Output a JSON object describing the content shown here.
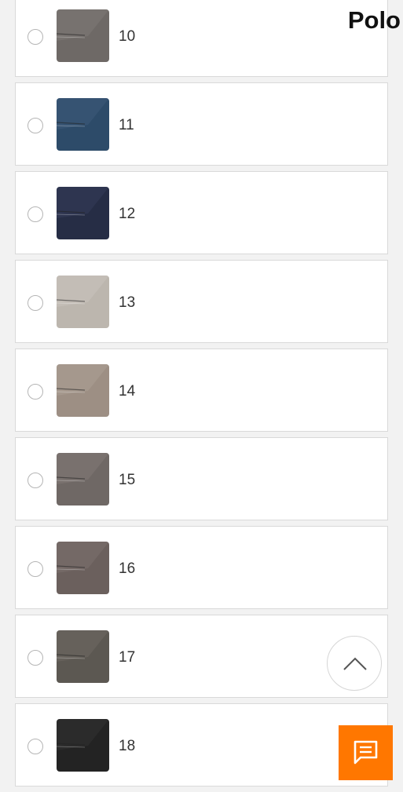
{
  "header": {
    "title": "Polo"
  },
  "options": [
    {
      "code": "10",
      "color": "#6e6966",
      "fold": "#8a8581"
    },
    {
      "code": "11",
      "color": "#2d4b69",
      "fold": "#486584"
    },
    {
      "code": "12",
      "color": "#262d45",
      "fold": "#3e4563"
    },
    {
      "code": "13",
      "color": "#bcb6ae",
      "fold": "#d1ccc5"
    },
    {
      "code": "14",
      "color": "#9d8f84",
      "fold": "#b5a89d"
    },
    {
      "code": "15",
      "color": "#6f6865",
      "fold": "#8c8582"
    },
    {
      "code": "16",
      "color": "#6b605d",
      "fold": "#877b78"
    },
    {
      "code": "17",
      "color": "#5c5852",
      "fold": "#78736d"
    },
    {
      "code": "18",
      "color": "#232323",
      "fold": "#3b3b3b"
    }
  ],
  "icons": {
    "scroll_top": "chevron-up-icon",
    "chat": "chat-icon"
  },
  "colors": {
    "accent": "#ff7700"
  }
}
